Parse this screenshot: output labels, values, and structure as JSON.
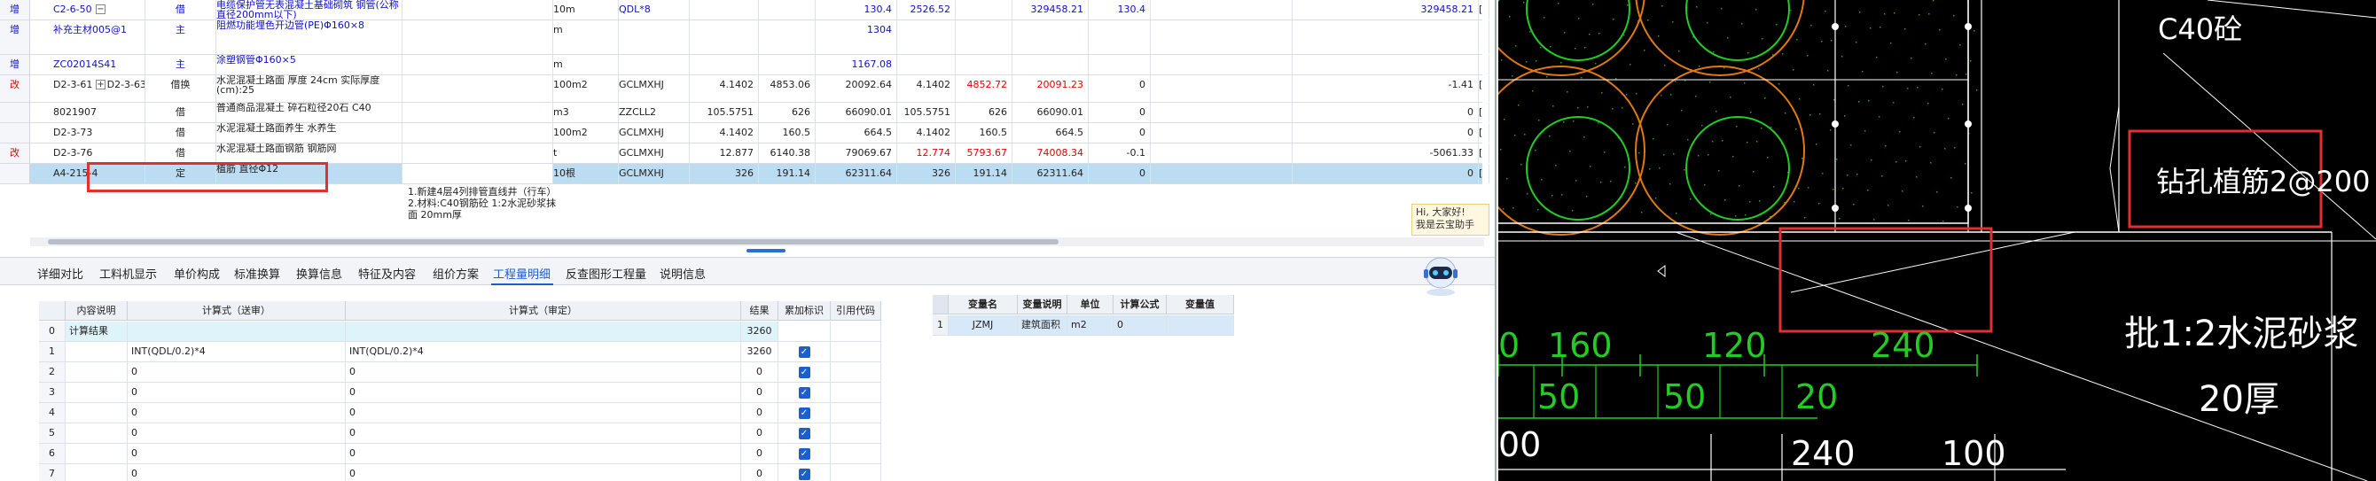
{
  "top_rows": [
    {
      "flag": "增",
      "code": "C2-6-50",
      "kind": "借",
      "name": "电缆保护管无表混凝土基础砌筑 钢管(公称直径200mm以下)",
      "unit": "10m",
      "qty_expr": "QDL*8",
      "qty": "",
      "price": "",
      "total": "130.4",
      "p2": "2526.52",
      "t2": "329458.21",
      "q2": "130.4",
      "diff": "",
      "final": "329458.21",
      "tail": "["
    },
    {
      "flag": "增",
      "code": "补充主材005@1",
      "kind": "主",
      "name": "阻燃功能埋色开边管(PE)Φ160×8",
      "unit": "m",
      "qty_expr": "",
      "qty": "",
      "price": "",
      "total": "1304",
      "p2": "",
      "t2": "",
      "q2": "",
      "diff": "",
      "final": "",
      "tail": ""
    },
    {
      "flag": "增",
      "code": "ZC02014S41",
      "kind": "主",
      "name": "涂塑钢管Φ160×5",
      "unit": "m",
      "qty_expr": "",
      "qty": "",
      "price": "",
      "total": "1167.08",
      "p2": "",
      "t2": "",
      "q2": "",
      "diff": "",
      "final": "",
      "tail": ""
    },
    {
      "flag": "改",
      "code": "D2-3-61 + D2-3-63",
      "kind": "借换",
      "name": "水泥混凝土路面 厚度 24cm 实际厚度(cm):25",
      "unit": "100m2",
      "qty_expr": "GCLMXHJ",
      "qty": "4.1402",
      "price": "4853.06",
      "total": "20092.64",
      "p2": "4.1402",
      "p3": "4852.72",
      "t2": "20091.23",
      "q2": "0",
      "diff": "",
      "final": "-1.41",
      "tail": "["
    },
    {
      "flag": "",
      "code": "8021907",
      "kind": "借",
      "name": "普通商品混凝土 碎石粒径20石 C40",
      "unit": "m3",
      "qty_expr": "ZZCLL2",
      "qty": "105.5751",
      "price": "626",
      "total": "66090.01",
      "p2": "105.5751",
      "p3": "626",
      "t2": "66090.01",
      "q2": "0",
      "diff": "",
      "final": "0",
      "tail": "["
    },
    {
      "flag": "",
      "code": "D2-3-73",
      "kind": "借",
      "name": "水泥混凝土路面养生 水养生",
      "unit": "100m2",
      "qty_expr": "GCLMXHJ",
      "qty": "4.1402",
      "price": "160.5",
      "total": "664.5",
      "p2": "4.1402",
      "p3": "160.5",
      "t2": "664.5",
      "q2": "0",
      "diff": "",
      "final": "0",
      "tail": "["
    },
    {
      "flag": "改",
      "code": "D2-3-76",
      "kind": "借",
      "name": "水泥混凝土路面钢筋 钢筋网",
      "unit": "t",
      "qty_expr": "GCLMXHJ",
      "qty": "12.877",
      "price": "6140.38",
      "total": "79069.67",
      "p2": "12.774",
      "p3": "5793.67",
      "t2": "74008.34",
      "q2": "-0.1",
      "diff": "",
      "final": "-5061.33",
      "tail": "["
    },
    {
      "flag": "",
      "code": "A4-215-4",
      "kind": "定",
      "name": "植筋 直径Φ12",
      "unit": "10根",
      "qty_expr": "GCLMXHJ",
      "qty": "326",
      "price": "191.14",
      "total": "62311.64",
      "p2": "326",
      "p3": "191.14",
      "t2": "62311.64",
      "q2": "0",
      "diff": "",
      "final": "0",
      "tail": "["
    }
  ],
  "desc_lines": [
    "1.新建4层4列排管直线井（行车）",
    "2.材料:C40钢筋砼 1:2水泥砂浆抹面 20mm厚"
  ],
  "assistant_tip": [
    "Hi, 大家好!",
    "我是云宝助手"
  ],
  "tabs": [
    "详细对比",
    "工料机显示",
    "单价构成",
    "标准换算",
    "换算信息",
    "特征及内容",
    "组价方案",
    "工程量明细",
    "反查图形工程量",
    "说明信息"
  ],
  "active_tab": "工程量明细",
  "detail_headers": [
    "内容说明",
    "计算式（送审）",
    "计算式（审定）",
    "结果",
    "累加标识",
    "引用代码"
  ],
  "detail_rows": [
    {
      "idx": "0",
      "desc": "计算结果",
      "f1": "",
      "f2": "",
      "result": "3260",
      "check": false
    },
    {
      "idx": "1",
      "desc": "",
      "f1": "INT(QDL/0.2)*4",
      "f2": "INT(QDL/0.2)*4",
      "result": "3260",
      "check": true
    },
    {
      "idx": "2",
      "desc": "",
      "f1": "0",
      "f2": "0",
      "result": "0",
      "check": true
    },
    {
      "idx": "3",
      "desc": "",
      "f1": "0",
      "f2": "0",
      "result": "0",
      "check": true
    },
    {
      "idx": "4",
      "desc": "",
      "f1": "0",
      "f2": "0",
      "result": "0",
      "check": true
    },
    {
      "idx": "5",
      "desc": "",
      "f1": "0",
      "f2": "0",
      "result": "0",
      "check": true
    },
    {
      "idx": "6",
      "desc": "",
      "f1": "0",
      "f2": "0",
      "result": "0",
      "check": true
    },
    {
      "idx": "7",
      "desc": "",
      "f1": "0",
      "f2": "0",
      "result": "0",
      "check": true
    }
  ],
  "var_headers": [
    "变量名",
    "变量说明",
    "单位",
    "计算公式",
    "变量值"
  ],
  "var_rows": [
    {
      "idx": "1",
      "name": "JZMJ",
      "desc": "建筑面积",
      "unit": "m2",
      "formula": "0",
      "value": ""
    }
  ],
  "cad": {
    "labels": {
      "c40": "C40砼",
      "anchor": "钻孔植筋2@200",
      "mortar": "批1:2水泥砂浆",
      "thick": "20厚"
    },
    "dims_row1": [
      "0",
      "160",
      "120",
      "240"
    ],
    "dims_row2": [
      "50",
      "50",
      "20"
    ],
    "dims_row3": [
      "00",
      "240",
      "100"
    ]
  },
  "colors": {
    "accent": "#1a5fd0",
    "highlight": "#e03030",
    "cad_bg": "#000000",
    "cad_green": "#22cc22",
    "cad_orange": "#e07a10"
  }
}
